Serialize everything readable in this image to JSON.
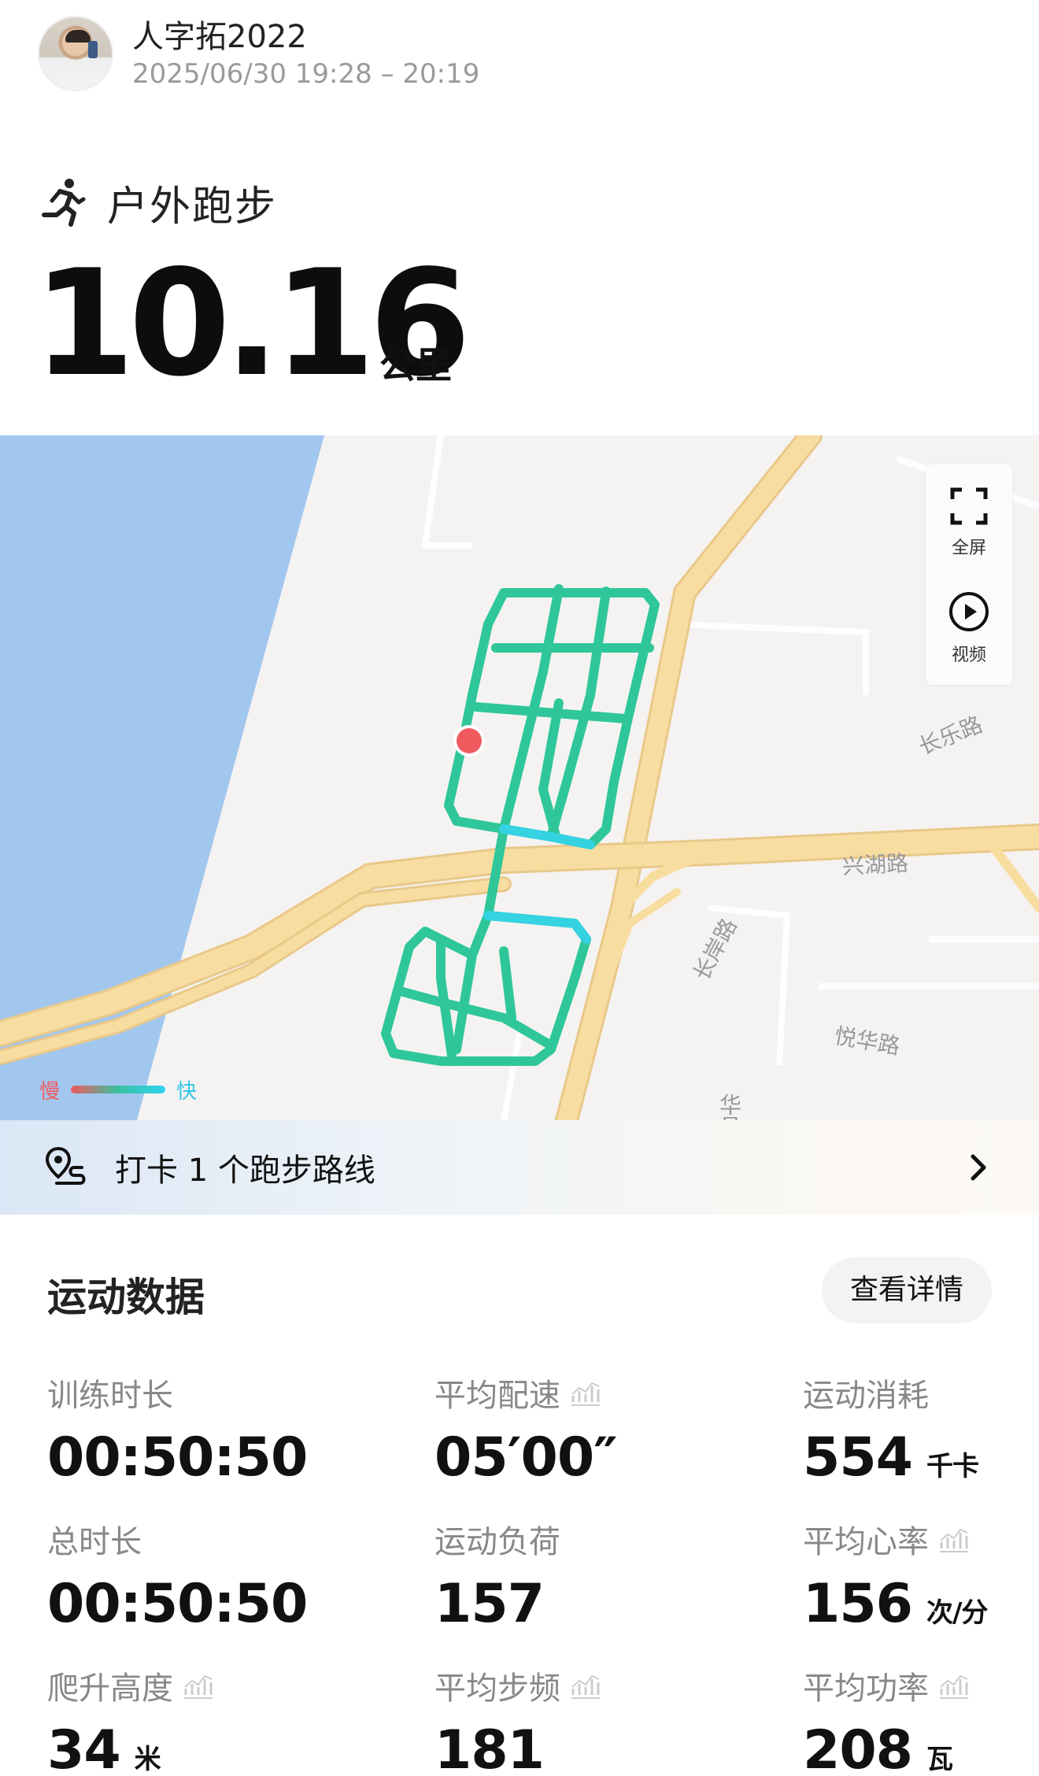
{
  "header": {
    "username": "人字拓2022",
    "datetime": "2025/06/30 19:28 – 20:19"
  },
  "activity": {
    "type_label": "户外跑步",
    "distance": "10.16",
    "distance_unit": "公里"
  },
  "map": {
    "roads": [
      "长岸路",
      "长乐路",
      "兴湖路",
      "华昌路",
      "悦华路"
    ],
    "tools": {
      "fullscreen": "全屏",
      "video": "视频"
    },
    "legend": {
      "slow": "慢",
      "fast": "快"
    },
    "colors": {
      "water": "#a2c7ef",
      "road": "#f8dda0",
      "route": "#2fc79a",
      "route_fast": "#36d3ef",
      "start_marker": "#ef5a5f"
    }
  },
  "checkin": {
    "text": "打卡 1 个跑步路线"
  },
  "stats": {
    "title": "运动数据",
    "detail_button": "查看详情",
    "items": [
      {
        "label": "训练时长",
        "value": "00:50:50",
        "unit": ""
      },
      {
        "label": "平均配速",
        "value": "05′00″",
        "unit": ""
      },
      {
        "label": "运动消耗",
        "value": "554",
        "unit": "千卡"
      },
      {
        "label": "总时长",
        "value": "00:50:50",
        "unit": ""
      },
      {
        "label": "运动负荷",
        "value": "157",
        "unit": ""
      },
      {
        "label": "平均心率",
        "value": "156",
        "unit": "次/分"
      },
      {
        "label": "爬升高度",
        "value": "34",
        "unit": "米"
      },
      {
        "label": "平均步频",
        "value": "181",
        "unit": ""
      },
      {
        "label": "平均功率",
        "value": "208",
        "unit": "瓦"
      }
    ]
  }
}
